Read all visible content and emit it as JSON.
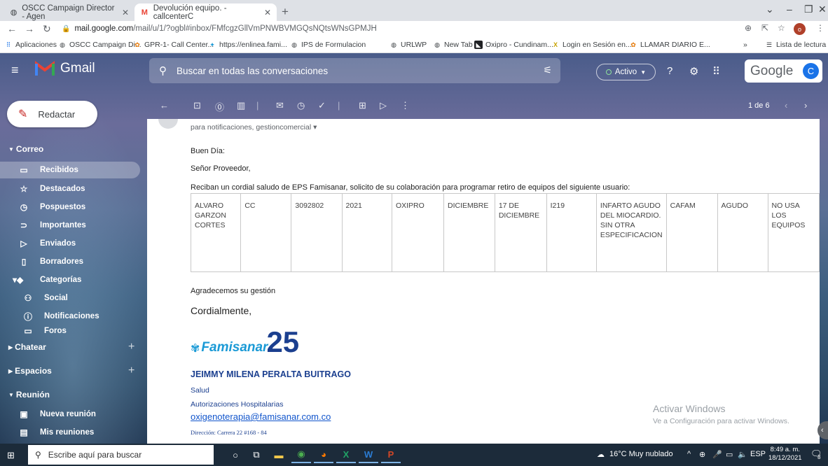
{
  "browser": {
    "tabs": [
      {
        "label": "OSCC Campaign Director - Agen",
        "icon": "globe-icon"
      },
      {
        "label": "Devolución equipo. - callcenterC",
        "icon": "gmail-icon"
      }
    ],
    "url_host": "mail.google.com",
    "url_path": "/mail/u/1/?ogbl#inbox/FMfcgzGllVmPNWBVMGQsNQtsWNsGPMJH",
    "profile_initial": "o",
    "bookmarks": [
      "Aplicaciones",
      "OSCC Campaign Di...",
      "GPR-1- Call Center...",
      "https://enlinea.fami...",
      "IPS de Formulacion",
      "URLWP",
      "New Tab",
      "Oxipro - Cundinam...",
      "Login en Sesión en...",
      "LLAMAR DIARIO E..."
    ],
    "reading_list": "Lista de lectura",
    "more": "»"
  },
  "gmail": {
    "logo_text": "Gmail",
    "search_placeholder": "Buscar en todas las conversaciones",
    "status": "Activo",
    "google_text": "Google",
    "avatar_initial": "C",
    "compose": "Redactar",
    "pagination": "1 de 6",
    "nav": {
      "mail_section": "Correo",
      "items": [
        {
          "label": "Recibidos",
          "icon": "inbox-icon"
        },
        {
          "label": "Destacados",
          "icon": "star-icon"
        },
        {
          "label": "Pospuestos",
          "icon": "clock-icon"
        },
        {
          "label": "Importantes",
          "icon": "important-icon"
        },
        {
          "label": "Enviados",
          "icon": "send-icon"
        },
        {
          "label": "Borradores",
          "icon": "draft-icon"
        },
        {
          "label": "Categorías",
          "icon": "label-icon"
        }
      ],
      "categories": [
        {
          "label": "Social",
          "icon": "people-icon"
        },
        {
          "label": "Notificaciones",
          "icon": "info-icon"
        },
        {
          "label": "Foros",
          "icon": "forum-icon"
        }
      ],
      "chat_section": "Chatear",
      "spaces_section": "Espacios",
      "meet_section": "Reunión",
      "meet_items": [
        {
          "label": "Nueva reunión",
          "icon": "video-icon"
        },
        {
          "label": "Mis reuniones",
          "icon": "calendar-icon"
        }
      ]
    }
  },
  "message": {
    "recipients": "para notificaciones, gestioncomercial ▾",
    "greeting": "Buen Día:",
    "salutation": "Señor Proveedor,",
    "intro": "Reciban un cordial saludo de EPS Famisanar, solicito de su colaboración para programar retiro de equipos del siguiente usuario:",
    "table_row": [
      "ALVARO GARZON CORTES",
      "CC",
      "3092802",
      "2021",
      "OXIPRO",
      "DICIEMBRE",
      "17 DE DICIEMBRE",
      "I219",
      "INFARTO AGUDO DEL MIOCARDIO. SIN OTRA ESPECIFICACION",
      "CAFAM",
      "AGUDO",
      "NO USA LOS EQUIPOS"
    ],
    "thanks": "Agradecemos su gestión",
    "closing": "Cordialmente,",
    "logo_brand": "Famisanar",
    "logo_number": "25",
    "sig_name": "JEIMMY MILENA PERALTA BUITRAGO",
    "sig_dept1": "Salud",
    "sig_dept2": "Autorizaciones Hospitalarias",
    "sig_email": "oxigenoterapia@famisanar.com.co",
    "sig_address": "Dirección: Carrera 22 #168 - 84"
  },
  "watermark": {
    "title": "Activar Windows",
    "subtitle": "Ve a Configuración para activar Windows."
  },
  "taskbar": {
    "search_placeholder": "Escribe aquí para buscar",
    "weather": "16°C  Muy nublado",
    "lang": "ESP",
    "time": "8:49 a. m.",
    "date": "18/12/2021",
    "notif_count": "3"
  }
}
